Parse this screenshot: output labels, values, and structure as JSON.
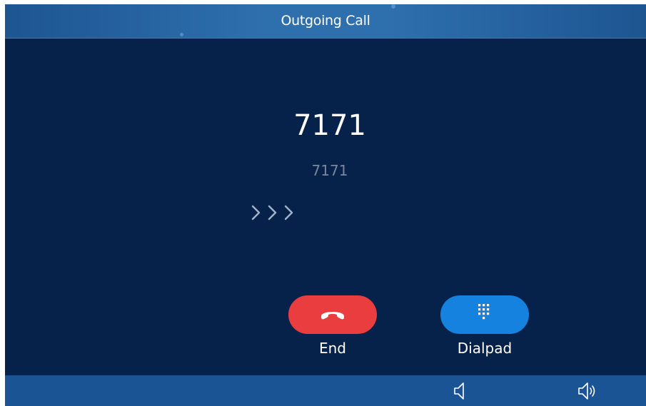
{
  "header": {
    "title": "Outgoing Call"
  },
  "call": {
    "name": "7171",
    "number": "7171",
    "progress_icon": "chevrons-right-icon"
  },
  "actions": {
    "end": {
      "label": "End",
      "icon": "phone-hangup-icon",
      "color": "#ea3d3f"
    },
    "dialpad": {
      "label": "Dialpad",
      "icon": "dialpad-icon",
      "color": "#1682df"
    }
  },
  "bottom_bar": {
    "volume_down_icon": "volume-down-icon",
    "volume_up_icon": "volume-up-icon"
  },
  "colors": {
    "background": "#07224a",
    "title_bar": "#2e6fae",
    "bottom_bar": "#1a5494",
    "secondary_text": "#7b8797"
  }
}
